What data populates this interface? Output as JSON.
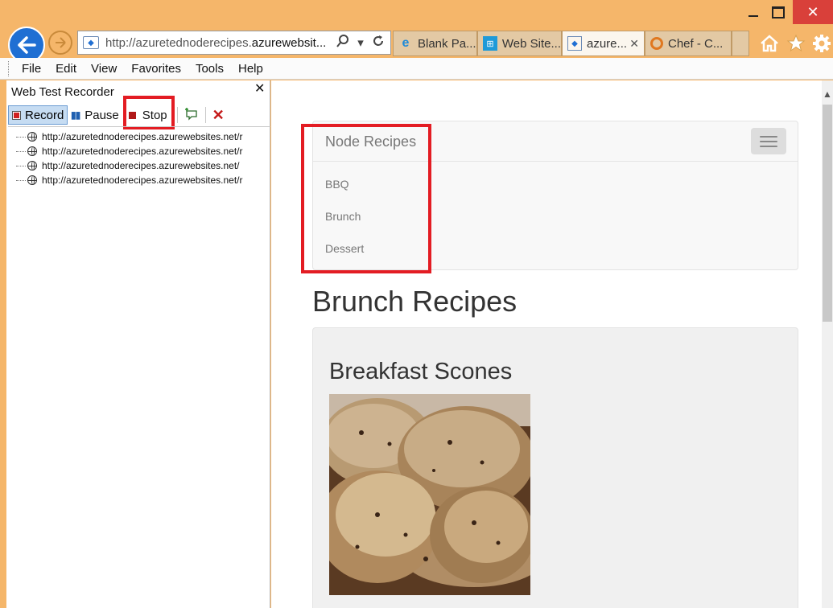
{
  "window": {
    "close_glyph": "✕"
  },
  "browser": {
    "address_prefix": "http://azuretednoderecipes.",
    "address_domain": "azurewebsit...",
    "tabs": [
      {
        "label": "Blank Pa...",
        "icon": "ie-icon"
      },
      {
        "label": "Web Site...",
        "icon": "windows-icon"
      },
      {
        "label": "azure...",
        "icon": "page-icon",
        "active": true
      },
      {
        "label": "Chef - C...",
        "icon": "chef-icon"
      }
    ]
  },
  "menu": [
    "File",
    "Edit",
    "View",
    "Favorites",
    "Tools",
    "Help"
  ],
  "recorder": {
    "title": "Web Test Recorder",
    "record_label": "Record",
    "pause_label": "Pause",
    "stop_label": "Stop",
    "requests": [
      "http://azuretednoderecipes.azurewebsites.net/r",
      "http://azuretednoderecipes.azurewebsites.net/r",
      "http://azuretednoderecipes.azurewebsites.net/",
      "http://azuretednoderecipes.azurewebsites.net/r"
    ]
  },
  "site": {
    "brand": "Node Recipes",
    "nav": [
      "BBQ",
      "Brunch",
      "Dessert"
    ],
    "heading": "Brunch Recipes",
    "recipe_title": "Breakfast Scones"
  },
  "colors": {
    "chrome": "#f5b66a",
    "highlight": "#e31c23",
    "accent": "#1f6fd3"
  }
}
